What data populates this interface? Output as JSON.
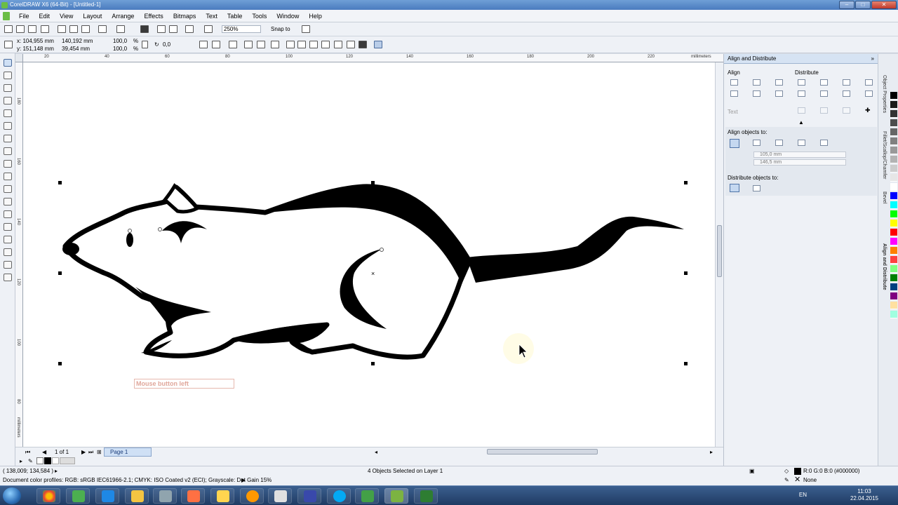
{
  "window": {
    "title": "CorelDRAW X6 (64-Bit) - [Untitled-1]"
  },
  "menu": [
    "File",
    "Edit",
    "View",
    "Layout",
    "Arrange",
    "Effects",
    "Bitmaps",
    "Text",
    "Table",
    "Tools",
    "Window",
    "Help"
  ],
  "toolbar": {
    "zoom": "250%",
    "snap_to": "Snap to"
  },
  "propertybar": {
    "x": "x: 104,955 mm",
    "y": "y: 151,148 mm",
    "width": "140,192 mm",
    "height": "39,454 mm",
    "scale_x": "100,0",
    "scale_y": "100,0",
    "scale_unit_x": "%",
    "scale_unit_y": "%",
    "rotation": "0,0"
  },
  "rulers": {
    "top_labels": [
      "20",
      "40",
      "60",
      "80",
      "100",
      "120",
      "140",
      "160",
      "180",
      "200",
      "220"
    ],
    "top_unit": "millimeters",
    "left_labels": [
      "180",
      "160",
      "140",
      "120",
      "100",
      "80"
    ],
    "left_unit": "millimeters"
  },
  "canvas": {
    "tooltip": "Mouse button left"
  },
  "pagebar": {
    "page_count": "1 of 1",
    "page_tab": "Page 1"
  },
  "docker": {
    "title": "Align and Distribute",
    "align_label": "Align",
    "distribute_label": "Distribute",
    "text_label": "Text",
    "align_objects_to": "Align objects to:",
    "x_value": "105,0 mm",
    "y_value": "146,5 mm",
    "distribute_objects_to": "Distribute objects to:"
  },
  "sidetabs": [
    "Object Properties",
    "Fillet/Scallop/Chamfer",
    "Bevel",
    "Align and Distribute"
  ],
  "status": {
    "cursor_position": "( 138,009; 134,584 )",
    "selection_info": "4 Objects Selected on Layer 1",
    "fill_info": "R:0 G:0 B:0 (#000000)",
    "outline_info": "None",
    "color_profiles": "Document color profiles: RGB: sRGB IEC61966-2.1; CMYK: ISO Coated v2 (ECI); Grayscale: Dot Gain 15%"
  },
  "taskbar": {
    "lang": "EN",
    "time": "11:03",
    "date": "22.04.2015"
  },
  "colors": {
    "palette": [
      "#000000",
      "#1a1a1a",
      "#333333",
      "#4d4d4d",
      "#666666",
      "#808080",
      "#999999",
      "#b3b3b3",
      "#cccccc",
      "#e6e6e6",
      "#ffffff",
      "#0000ff",
      "#00ffff",
      "#00ff00",
      "#ffff00",
      "#ff0000",
      "#ff00ff",
      "#ff8000",
      "#ff4040",
      "#80ff80",
      "#008000",
      "#004080",
      "#800080",
      "#ffe0a0",
      "#a0ffe0"
    ]
  }
}
